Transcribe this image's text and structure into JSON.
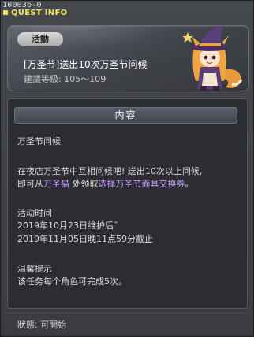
{
  "window": {
    "id": "100036-0",
    "title": "QUEST INFO"
  },
  "header": {
    "badge": "活動",
    "quest_title": "[万圣节]送出10次万圣节问候",
    "recommended_level": "建議等級: 105～109"
  },
  "content": {
    "section_title": "内容",
    "lines": {
      "l1": "万圣节问候",
      "l2": "在夜店万圣节中互相问候吧! 送出10次以上问候,",
      "l3_pre": "即可从",
      "l3_npc": "万圣猫",
      "l3_mid": " 处领取",
      "l3_item": "选择万圣节面具交换券",
      "l3_end": "。",
      "l4": "活动时间",
      "l5": "2019年10月23日维护后˜",
      "l6": "2019年11月05日晚11点59分截止",
      "l7": "温馨提示",
      "l8": "该任务每个角色可完成5次。"
    }
  },
  "footer": {
    "status": "狀態: 可開始"
  },
  "colors": {
    "title_yellow": "#f2e35a",
    "highlight_purple": "#c39cff"
  },
  "icons": {
    "portrait": "witch-character-portrait"
  }
}
